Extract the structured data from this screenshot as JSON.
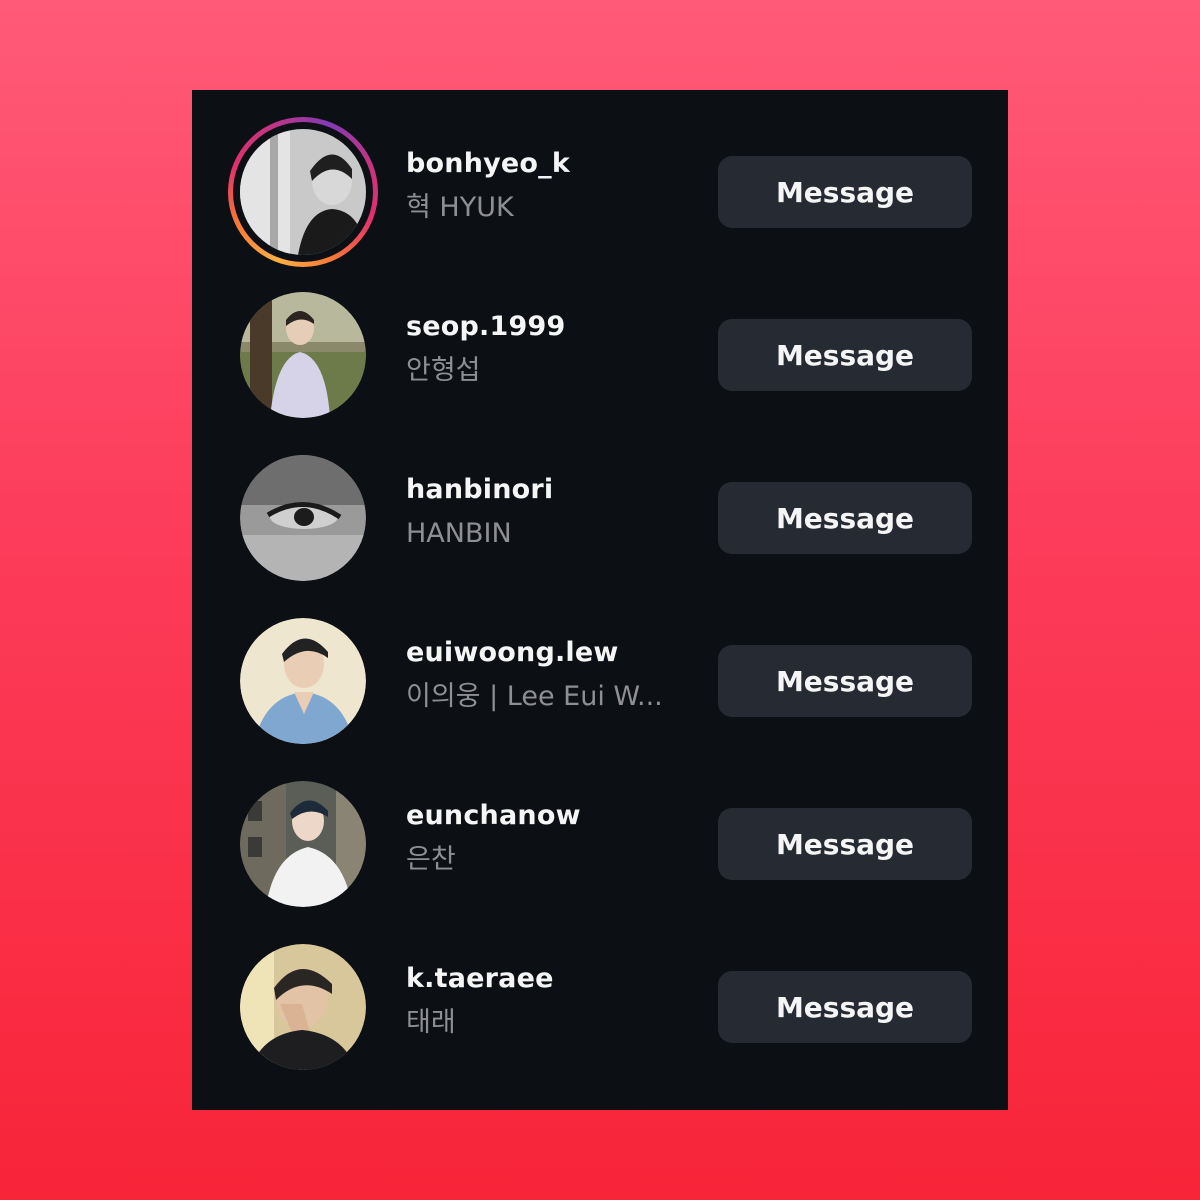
{
  "list": {
    "rows": [
      {
        "username": "bonhyeo_k",
        "full_name": "혁 HYUK",
        "button_label": "Message",
        "has_story_ring": true,
        "avatar_icon": "profile-photo-grayscale"
      },
      {
        "username": "seop.1999",
        "full_name": "안형섭",
        "button_label": "Message",
        "has_story_ring": false,
        "avatar_icon": "profile-photo-outdoor"
      },
      {
        "username": "hanbinori",
        "full_name": "HANBIN",
        "button_label": "Message",
        "has_story_ring": false,
        "avatar_icon": "profile-photo-eye-closeup"
      },
      {
        "username": "euiwoong.lew",
        "full_name": "이의웅 | Lee Eui W...",
        "button_label": "Message",
        "has_story_ring": false,
        "avatar_icon": "profile-photo-portrait"
      },
      {
        "username": "eunchanow",
        "full_name": "은찬",
        "button_label": "Message",
        "has_story_ring": false,
        "avatar_icon": "profile-photo-street"
      },
      {
        "username": "k.taeraee",
        "full_name": "태래",
        "button_label": "Message",
        "has_story_ring": false,
        "avatar_icon": "profile-photo-selfie"
      }
    ]
  },
  "colors": {
    "background_top": "#ff5a78",
    "background_bottom": "#f82438",
    "panel": "#0c1014",
    "button": "#262a32",
    "username_text": "#f5f5f5",
    "fullname_text": "#8e8e93"
  }
}
